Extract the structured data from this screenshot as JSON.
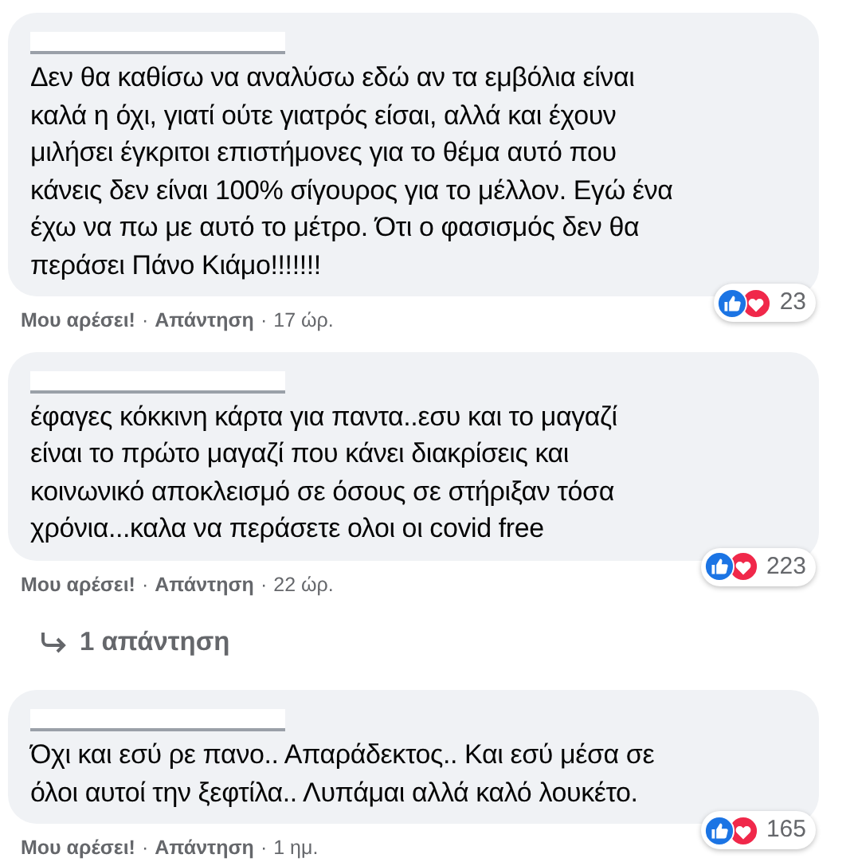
{
  "comments": [
    {
      "text": "Δεν θα καθίσω να αναλύσω εδώ αν τα εμβόλια είναι\nκαλά η όχι, γιατί ούτε γιατρός είσαι, αλλά και έχουν\nμιλήσει έγκριτοι επιστήμονες για το θέμα αυτό που\nκάνεις δεν είναι 100% σίγουρος για το μέλλον. Εγώ ένα\nέχω να πω με αυτό το μέτρο. Ότι ο φασισμός δεν θα\nπεράσει Πάνο Κιάμο!!!!!!!",
      "like_label": "Μου αρέσει!",
      "reply_label": "Απάντηση",
      "time": "17 ώρ.",
      "reactions": "23"
    },
    {
      "text": "έφαγες κόκκινη κάρτα για παντα..εσυ και το μαγαζί\nείναι το πρώτο μαγαζί που κάνει διακρίσεις και\nκοινωνικό αποκλεισμό σε όσους σε στήριξαν τόσα\nχρόνια...καλα να περάσετε ολοι οι covid free",
      "like_label": "Μου αρέσει!",
      "reply_label": "Απάντηση",
      "time": "22 ώρ.",
      "reactions": "223",
      "replies": "1 απάντηση"
    },
    {
      "text": "Όχι και εσύ ρε πανο.. Απαράδεκτος.. Και εσύ μέσα σε\nόλοι αυτοί την ξεφτίλα.. Λυπάμαι αλλά καλό λουκέτο.",
      "like_label": "Μου αρέσει!",
      "reply_label": "Απάντηση",
      "time": "1 ημ.",
      "reactions": "165"
    }
  ],
  "separator": "·"
}
